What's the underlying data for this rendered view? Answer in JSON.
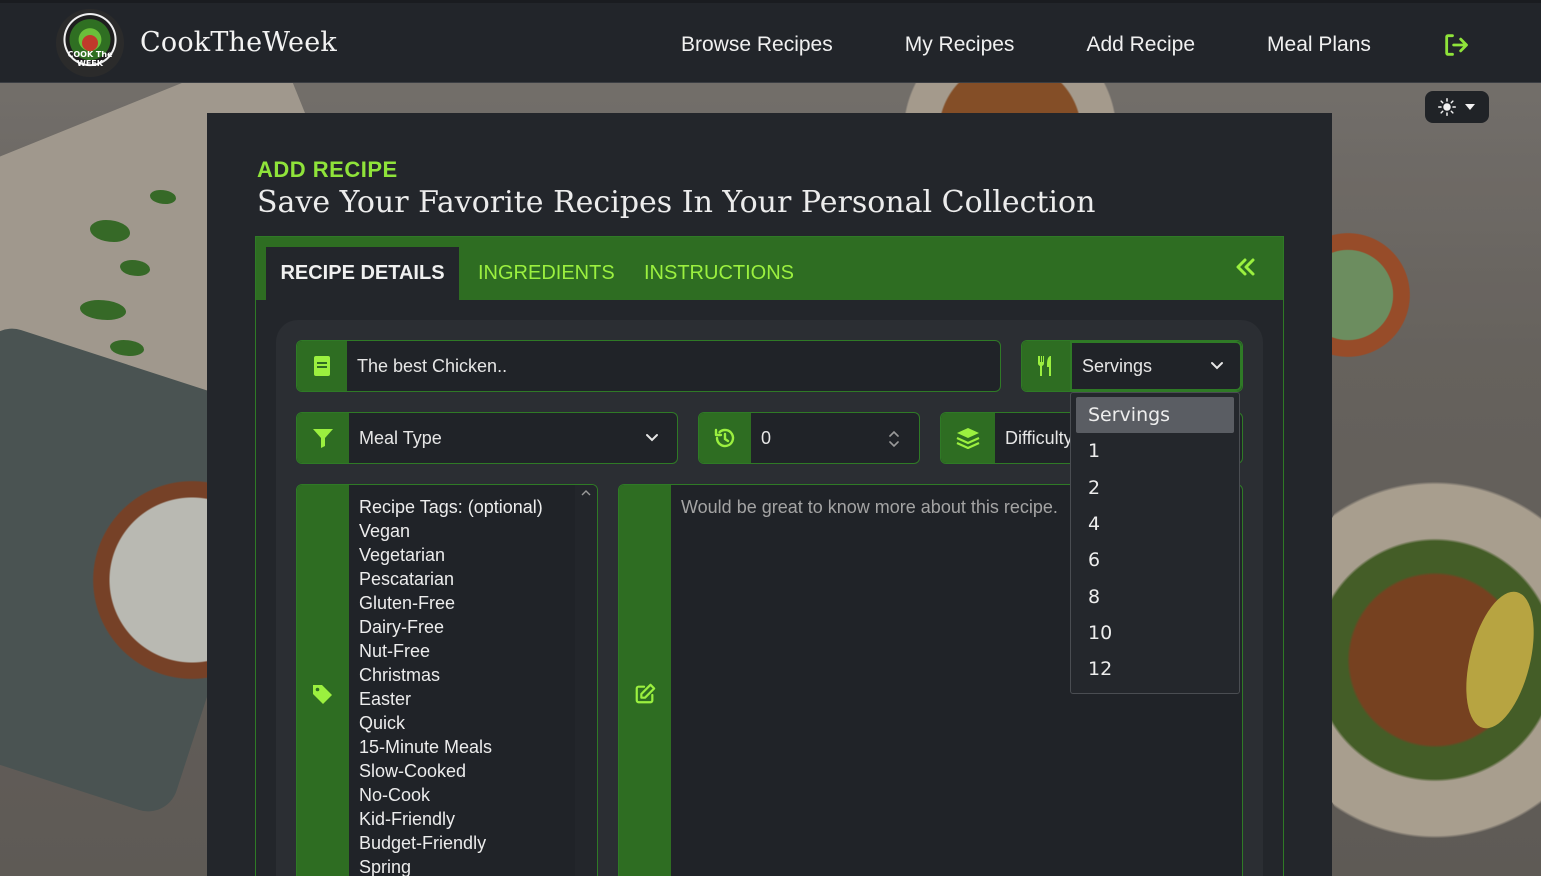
{
  "brand": {
    "name": "CookTheWeek",
    "logo_text": "COOK The WEEK"
  },
  "nav": {
    "links": [
      "Browse Recipes",
      "My Recipes",
      "Add Recipe",
      "Meal Plans"
    ],
    "logout_icon": "logout-icon"
  },
  "theme": {
    "icon": "sun-icon"
  },
  "page": {
    "kicker": "ADD RECIPE",
    "headline": "Save Your Favorite Recipes In Your Personal Collection"
  },
  "tabs": [
    "RECIPE DETAILS",
    "INGREDIENTS",
    "INSTRUCTIONS"
  ],
  "form": {
    "title_value": "The best Chicken..",
    "servings_selected": "Servings",
    "meal_type_selected": "Meal Type",
    "time_value": "0",
    "difficulty_selected": "Difficulty",
    "tags_list": [
      "Recipe Tags: (optional)",
      "Vegan",
      "Vegetarian",
      "Pescatarian",
      "Gluten-Free",
      "Dairy-Free",
      "Nut-Free",
      "Christmas",
      "Easter",
      "Quick",
      "15-Minute Meals",
      "Slow-Cooked",
      "No-Cook",
      "Kid-Friendly",
      "Budget-Friendly",
      "Spring"
    ],
    "description_placeholder": "Would be great to know more about this recipe."
  },
  "servings_dropdown": {
    "options": [
      "Servings",
      "1",
      "2",
      "4",
      "6",
      "8",
      "10",
      "12"
    ],
    "highlighted": "Servings"
  },
  "colors": {
    "accent_green": "#8fe33a",
    "tab_green": "#2e6d22",
    "card_dark": "#23262b",
    "nav_dark": "#22252a"
  }
}
